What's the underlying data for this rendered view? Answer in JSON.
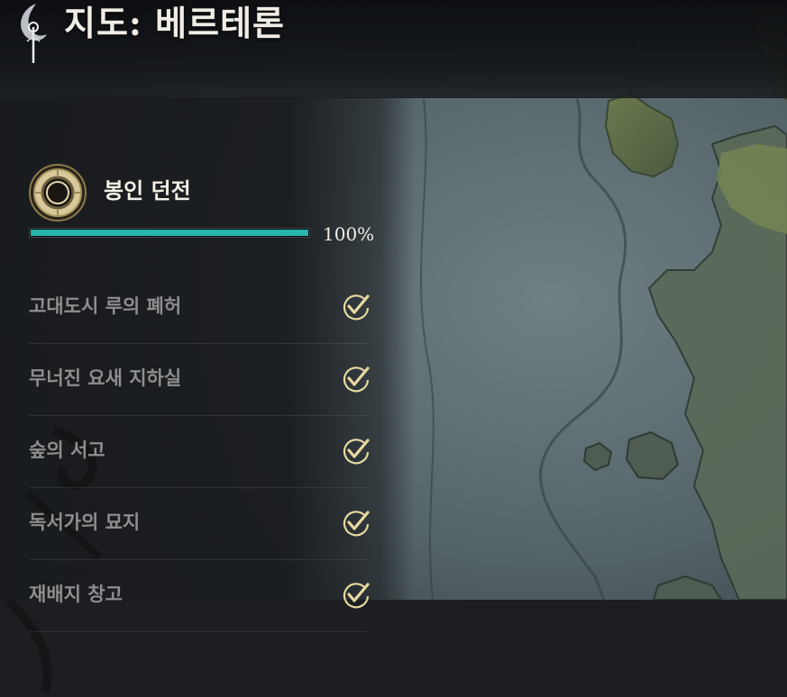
{
  "header": {
    "title": "지도: 베르테론",
    "emblem_icon": "crescent-emblem-icon"
  },
  "category": {
    "icon": "sealed-ring-icon",
    "title": "봉인 던전",
    "progress": 1.0,
    "progress_label": "100%"
  },
  "dungeons": [
    {
      "name": "고대도시 루의 폐허",
      "completed": true
    },
    {
      "name": "무너진 요새 지하실",
      "completed": true
    },
    {
      "name": "숲의 서고",
      "completed": true
    },
    {
      "name": "독서가의 묘지",
      "completed": true
    },
    {
      "name": "재배지 창고",
      "completed": true
    }
  ],
  "colors": {
    "progress_fill": "#27b5ad",
    "check": "#e8d9a0",
    "title_text": "#f1ede4",
    "item_text": "#8d8e8f"
  }
}
